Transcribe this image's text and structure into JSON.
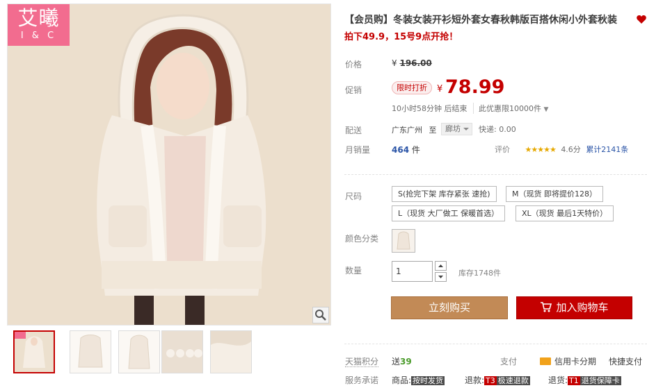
{
  "brand": {
    "logo_cn": "艾曦",
    "logo_en": "I & C"
  },
  "product": {
    "title": "【会员购】冬装女装开衫短外套女春秋韩版百搭休闲小外套秋装",
    "subtitle": "拍下49.9，15号9点开抢！"
  },
  "price": {
    "label": "价格",
    "currency": "¥",
    "original": "196.00"
  },
  "promo": {
    "label": "促销",
    "tag": "限时打折",
    "currency": "¥",
    "price": "78.99",
    "countdown": "10小时58分钟 后结束",
    "limit": "此优惠限10000件"
  },
  "shipping": {
    "label": "配送",
    "origin": "广东广州",
    "to": "至",
    "destination": "廊坊",
    "fee": "快递: 0.00"
  },
  "sales": {
    "label": "月销量",
    "count": "464",
    "unit": "件",
    "rating_label": "评价",
    "stars": "★★★★★",
    "score": "4.6分",
    "reviews": "累计2141条"
  },
  "size": {
    "label": "尺码",
    "options": [
      "S(抢完下架 库存紧张 速抢)",
      "M（现货 即将提价128）",
      "L（现货 大厂做工 保暖首选）",
      "XL（现货 最后1天特价）"
    ]
  },
  "color": {
    "label": "颜色分类"
  },
  "quantity": {
    "label": "数量",
    "value": "1",
    "stock": "库存1748件"
  },
  "actions": {
    "buy_now": "立刻购买",
    "add_to_cart": "加入购物车"
  },
  "footer": {
    "points_label": "天猫积分",
    "points_send": "送",
    "points_value": "39",
    "pay_label": "支付",
    "credit": "信用卡分期",
    "fast_pay": "快捷支付",
    "service_label": "服务承诺",
    "goods": "商品:",
    "goods_badge": "按时发货",
    "refund1": "退款:",
    "refund1_code": "T3",
    "refund1_badge": "极速退款",
    "refund2": "退货:",
    "refund2_code": "T1",
    "refund2_badge": "退货保障卡"
  },
  "colors": {
    "accent_red": "#c40000",
    "buy_brown": "#c28a56",
    "link_blue": "#2953a6",
    "logo_pink": "#f26c8f"
  }
}
